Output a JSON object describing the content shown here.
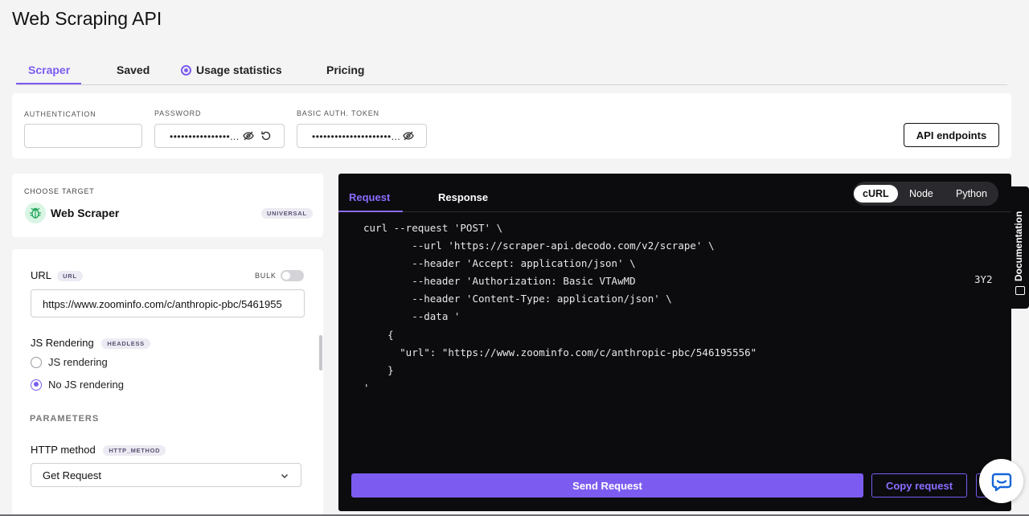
{
  "page": {
    "title": "Web Scraping API"
  },
  "tabs": [
    {
      "label": "Scraper"
    },
    {
      "label": "Saved"
    },
    {
      "label": "Usage statistics"
    },
    {
      "label": "Pricing"
    }
  ],
  "auth": {
    "authentication_label": "AUTHENTICATION",
    "authentication_value": "",
    "password_label": "PASSWORD",
    "password_value": "••••••••••••••••...",
    "token_label": "BASIC AUTH. TOKEN",
    "token_value": "•••••••••••••••••••••...",
    "api_endpoints_label": "API endpoints"
  },
  "target": {
    "heading": "CHOOSE TARGET",
    "name": "Web Scraper",
    "badge": "UNIVERSAL",
    "icon": "bug-icon"
  },
  "params": {
    "url_label": "URL",
    "url_badge": "URL",
    "bulk_label": "BULK",
    "url_value": "https://www.zoominfo.com/c/anthropic-pbc/5461955",
    "js_label": "JS Rendering",
    "js_badge": "HEADLESS",
    "js_option_1": "JS rendering",
    "js_option_2": "No JS rendering",
    "section_heading": "PARAMETERS",
    "http_label": "HTTP method",
    "http_badge": "HTTP_METHOD",
    "http_value": "Get Request"
  },
  "code": {
    "tab_request": "Request",
    "tab_response": "Response",
    "languages": [
      "cURL",
      "Node",
      "Python"
    ],
    "snippet": "curl --request 'POST' \\\n        --url 'https://scraper-api.decodo.com/v2/scrape' \\\n        --header 'Accept: application/json' \\\n        --header 'Authorization: Basic VTAwMD\n        --header 'Content-Type: application/json' \\\n        --data '\n    {\n      \"url\": \"https://www.zoominfo.com/c/anthropic-pbc/546195556\"\n    }\n'",
    "side_fragment": "3Y2",
    "send_label": "Send Request",
    "copy_label": "Copy request"
  },
  "documentation": {
    "label": "Documentation"
  },
  "colors": {
    "accent": "#7c5cf0",
    "code_bg": "#0c0c0f"
  }
}
